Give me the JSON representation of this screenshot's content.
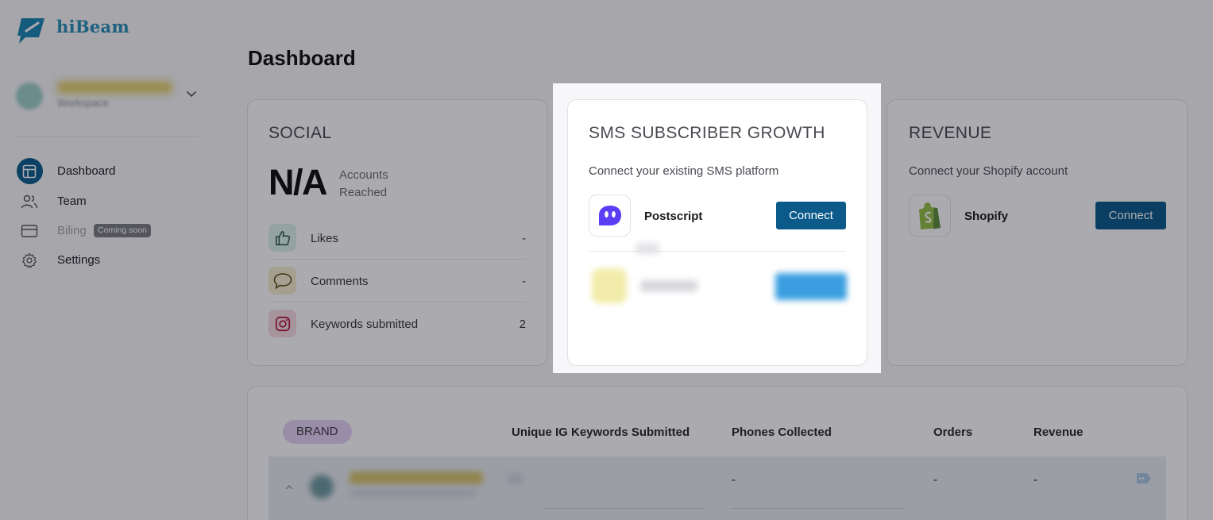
{
  "app": {
    "logo_text": "hiBeam"
  },
  "workspace": {
    "label": "Workspace"
  },
  "sidebar": {
    "items": [
      {
        "label": "Dashboard",
        "icon": "layout-icon",
        "active": true
      },
      {
        "label": "Team",
        "icon": "users-icon"
      },
      {
        "label": "Biling",
        "icon": "credit-card-icon",
        "badge": "Coming soon",
        "disabled": true
      },
      {
        "label": "Settings",
        "icon": "gear-icon"
      }
    ]
  },
  "page": {
    "title": "Dashboard"
  },
  "social": {
    "heading": "SOCIAL",
    "big_value": "N/A",
    "big_label_line1": "Accounts",
    "big_label_line2": "Reached",
    "metrics": [
      {
        "label": "Likes",
        "value": "-",
        "icon": "thumbs-up-icon"
      },
      {
        "label": "Comments",
        "value": "-",
        "icon": "comment-icon"
      },
      {
        "label": "Keywords submitted",
        "value": "2",
        "icon": "instagram-icon"
      }
    ]
  },
  "sms": {
    "heading": "SMS SUBSCRIBER GROWTH",
    "subtitle": "Connect your existing SMS platform",
    "apps": [
      {
        "name": "Postscript",
        "button": "Connect",
        "icon": "postscript-icon"
      }
    ]
  },
  "revenue": {
    "heading": "REVENUE",
    "subtitle": "Connect your Shopify account",
    "app": {
      "name": "Shopify",
      "button": "Connect",
      "icon": "shopify-icon"
    }
  },
  "table": {
    "brand_label": "BRAND",
    "columns": [
      "Unique IG Keywords Submitted",
      "Phones Collected",
      "Orders",
      "Revenue"
    ],
    "rows": [
      {
        "phones": "-",
        "orders": "-",
        "revenue": "-"
      }
    ]
  },
  "colors": {
    "primary": "#0b5a8a",
    "accent": "#2a8fb5",
    "brand_pill": "#e4d2f5"
  }
}
